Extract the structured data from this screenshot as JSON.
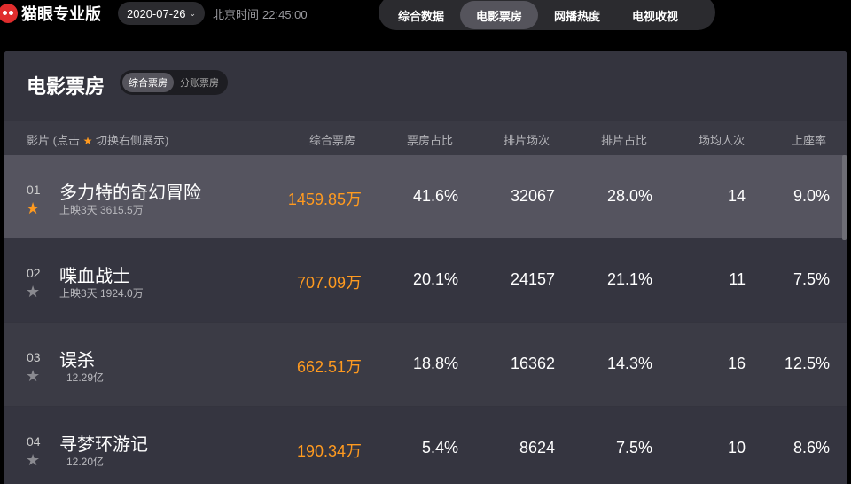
{
  "app": {
    "logo_text": "猫眼专业版"
  },
  "header": {
    "date": "2020-07-26",
    "date_caret": "⌄",
    "clock_label": "北京时间",
    "clock_time": "22:45:00"
  },
  "nav": {
    "tabs": [
      "综合数据",
      "电影票房",
      "网播热度",
      "电视收视"
    ],
    "active": "电影票房"
  },
  "panel": {
    "title": "电影票房",
    "subtabs": [
      "综合票房",
      "分账票房"
    ],
    "active_subtab": "综合票房"
  },
  "table": {
    "film_header_prefix": "影片 (点击",
    "film_header_suffix": "切换右侧展示)",
    "columns": [
      "综合票房",
      "票房占比",
      "排片场次",
      "排片占比",
      "场均人次",
      "上座率"
    ],
    "rows": [
      {
        "rank": "01",
        "starred": true,
        "name": "多力特的奇幻冒险",
        "meta": "上映3天   3615.5万",
        "box": "1459.85万",
        "share": "41.6%",
        "shows": "32067",
        "show_share": "28.0%",
        "avg": "14",
        "occupancy": "9.0%"
      },
      {
        "rank": "02",
        "starred": false,
        "name": "喋血战士",
        "meta": "上映3天   1924.0万",
        "box": "707.09万",
        "share": "20.1%",
        "shows": "24157",
        "show_share": "21.1%",
        "avg": "11",
        "occupancy": "7.5%"
      },
      {
        "rank": "03",
        "starred": false,
        "name": "误杀",
        "meta": "12.29亿",
        "box": "662.51万",
        "share": "18.8%",
        "shows": "16362",
        "show_share": "14.3%",
        "avg": "16",
        "occupancy": "12.5%"
      },
      {
        "rank": "04",
        "starred": false,
        "name": "寻梦环游记",
        "meta": "12.20亿",
        "box": "190.34万",
        "share": "5.4%",
        "shows": "8624",
        "show_share": "7.5%",
        "avg": "10",
        "occupancy": "8.6%"
      }
    ]
  },
  "colors": {
    "accent": "#ff9a1f",
    "brand": "#e02d2d",
    "panel": "#34343e"
  },
  "icons": {
    "star": "star-icon",
    "logo": "cat-eye-logo-icon",
    "caret": "chevron-down-icon"
  }
}
